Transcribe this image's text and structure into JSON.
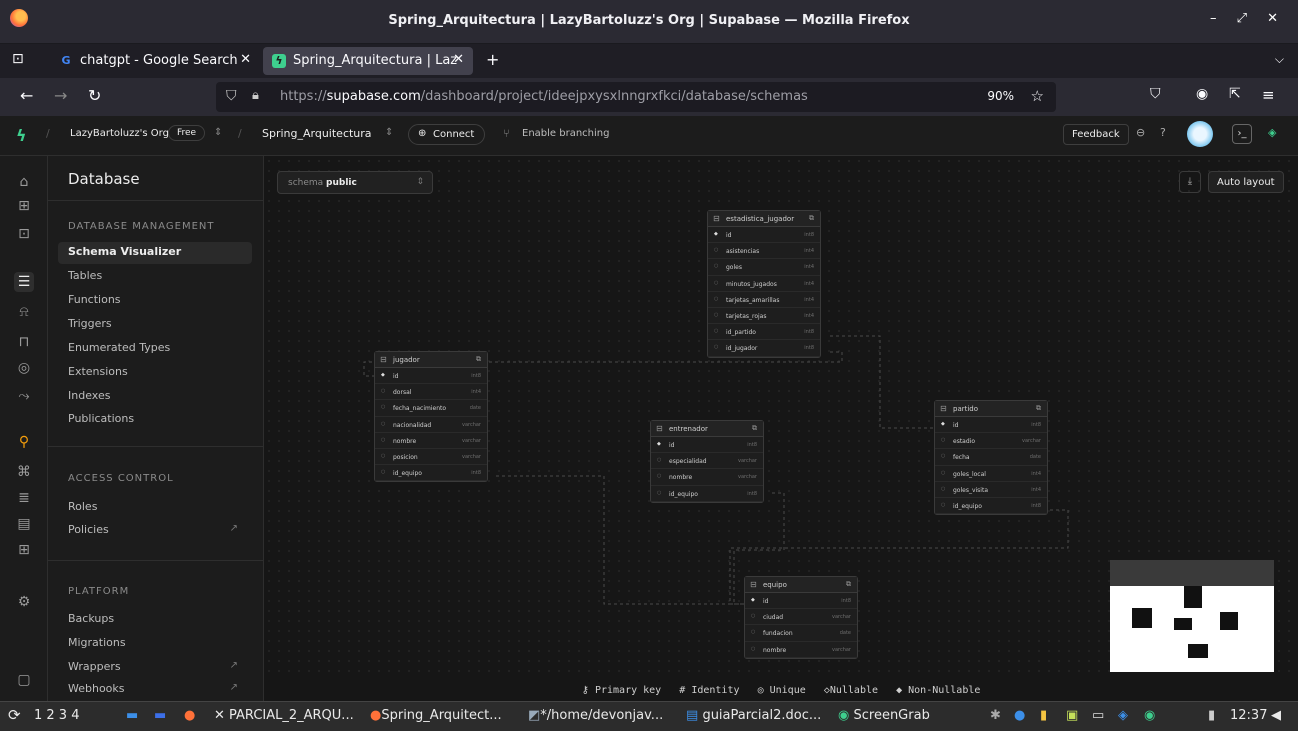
{
  "window": {
    "title": "Spring_Arquitectura | LazyBartoluzz's Org | Supabase — Mozilla Firefox",
    "controls": "– ⤢ ✕"
  },
  "tabs": [
    {
      "label": "chatgpt - Google Search",
      "icon": "google-icon"
    },
    {
      "label": "Spring_Arquitectura | Laz",
      "icon": "supabase-icon"
    }
  ],
  "nav": {
    "url_prefix": "https://",
    "url_domain": "supabase.com",
    "url_path": "/dashboard/project/ideejpxysxlnngrxfkci/database/schemas",
    "zoom": "90%"
  },
  "header": {
    "org": "LazyBartoluzz's Org",
    "plan": "Free",
    "project": "Spring_Arquitectura",
    "connect": "Connect",
    "branching": "Enable branching",
    "feedback": "Feedback"
  },
  "sidebar": {
    "title": "Database",
    "sections": [
      {
        "label": "DATABASE MANAGEMENT",
        "items": [
          "Schema Visualizer",
          "Tables",
          "Functions",
          "Triggers",
          "Enumerated Types",
          "Extensions",
          "Indexes",
          "Publications"
        ]
      },
      {
        "label": "ACCESS CONTROL",
        "items": [
          "Roles",
          "Policies"
        ]
      },
      {
        "label": "PLATFORM",
        "items": [
          "Backups",
          "Migrations",
          "Wrappers",
          "Webhooks"
        ]
      }
    ]
  },
  "toolbar": {
    "schema_prefix": "schema",
    "schema_value": "public",
    "auto_layout": "Auto layout"
  },
  "tables": {
    "estadistica_jugador": {
      "name": "estadistica_jugador",
      "rows": [
        [
          "id",
          "int8"
        ],
        [
          "asistencias",
          "int4"
        ],
        [
          "goles",
          "int4"
        ],
        [
          "minutos_jugados",
          "int4"
        ],
        [
          "tarjetas_amarillas",
          "int4"
        ],
        [
          "tarjetas_rojas",
          "int4"
        ],
        [
          "id_partido",
          "int8"
        ],
        [
          "id_jugador",
          "int8"
        ]
      ]
    },
    "jugador": {
      "name": "jugador",
      "rows": [
        [
          "id",
          "int8"
        ],
        [
          "dorsal",
          "int4"
        ],
        [
          "fecha_nacimiento",
          "date"
        ],
        [
          "nacionalidad",
          "varchar"
        ],
        [
          "nombre",
          "varchar"
        ],
        [
          "posicion",
          "varchar"
        ],
        [
          "id_equipo",
          "int8"
        ]
      ]
    },
    "entrenador": {
      "name": "entrenador",
      "rows": [
        [
          "id",
          "int8"
        ],
        [
          "especialidad",
          "varchar"
        ],
        [
          "nombre",
          "varchar"
        ],
        [
          "id_equipo",
          "int8"
        ]
      ]
    },
    "partido": {
      "name": "partido",
      "rows": [
        [
          "id",
          "int8"
        ],
        [
          "estadio",
          "varchar"
        ],
        [
          "fecha",
          "date"
        ],
        [
          "goles_local",
          "int4"
        ],
        [
          "goles_visita",
          "int4"
        ],
        [
          "id_equipo",
          "int8"
        ]
      ]
    },
    "equipo": {
      "name": "equipo",
      "rows": [
        [
          "id",
          "int8"
        ],
        [
          "ciudad",
          "varchar"
        ],
        [
          "fundacion",
          "date"
        ],
        [
          "nombre",
          "varchar"
        ]
      ]
    }
  },
  "legend": {
    "primary": "Primary key",
    "identity": "Identity",
    "unique": "Unique",
    "nullable": "Nullable",
    "nonnullable": "Non-Nullable"
  },
  "taskbar": {
    "workspaces": "1  2  3  4",
    "tasks": [
      "PARCIAL_2_ARQU...",
      "Spring_Arquitect...",
      "*/home/devonjav...",
      "guiaParcial2.doc...",
      "ScreenGrab"
    ],
    "clock": "12:37"
  }
}
